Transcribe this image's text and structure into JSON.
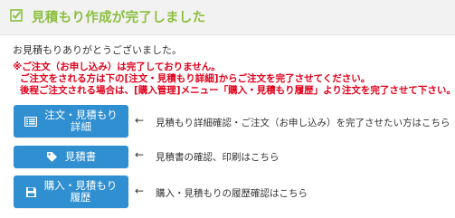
{
  "header": {
    "title": "見積もり作成が完了しました",
    "accent_color": "#8cbf3f",
    "icon": "check-box-icon"
  },
  "message": {
    "thanks": "お見積もりありがとうございました。"
  },
  "warnings": [
    "※ご注文（お申し込み）は完了しておりません。",
    "ご注文をされる方は下の[注文・見積もり詳細]からご注文を完了させてください。",
    "後程ご注文される場合は、[購入管理]メニュー「購入・見積もり履歴」より注文を完了させて下さい。"
  ],
  "warning_color": "#e0001b",
  "actions": [
    {
      "label_line1": "注文・見積もり",
      "label_line2": "詳細",
      "icon": "list-icon",
      "arrow": "←",
      "description": "見積もり詳細確認・ご注文（お申し込み）を完了させたい方はこちら"
    },
    {
      "label_line1": "見積書",
      "label_line2": "",
      "icon": "tag-icon",
      "arrow": "←",
      "description": "見積書の確認、印刷はこちら"
    },
    {
      "label_line1": "購入・見積もり",
      "label_line2": "履歴",
      "icon": "floppy-disk-icon",
      "arrow": "←",
      "description": "購入・見積もりの履歴確認はこちら"
    }
  ],
  "button_color": "#2f8fd1"
}
